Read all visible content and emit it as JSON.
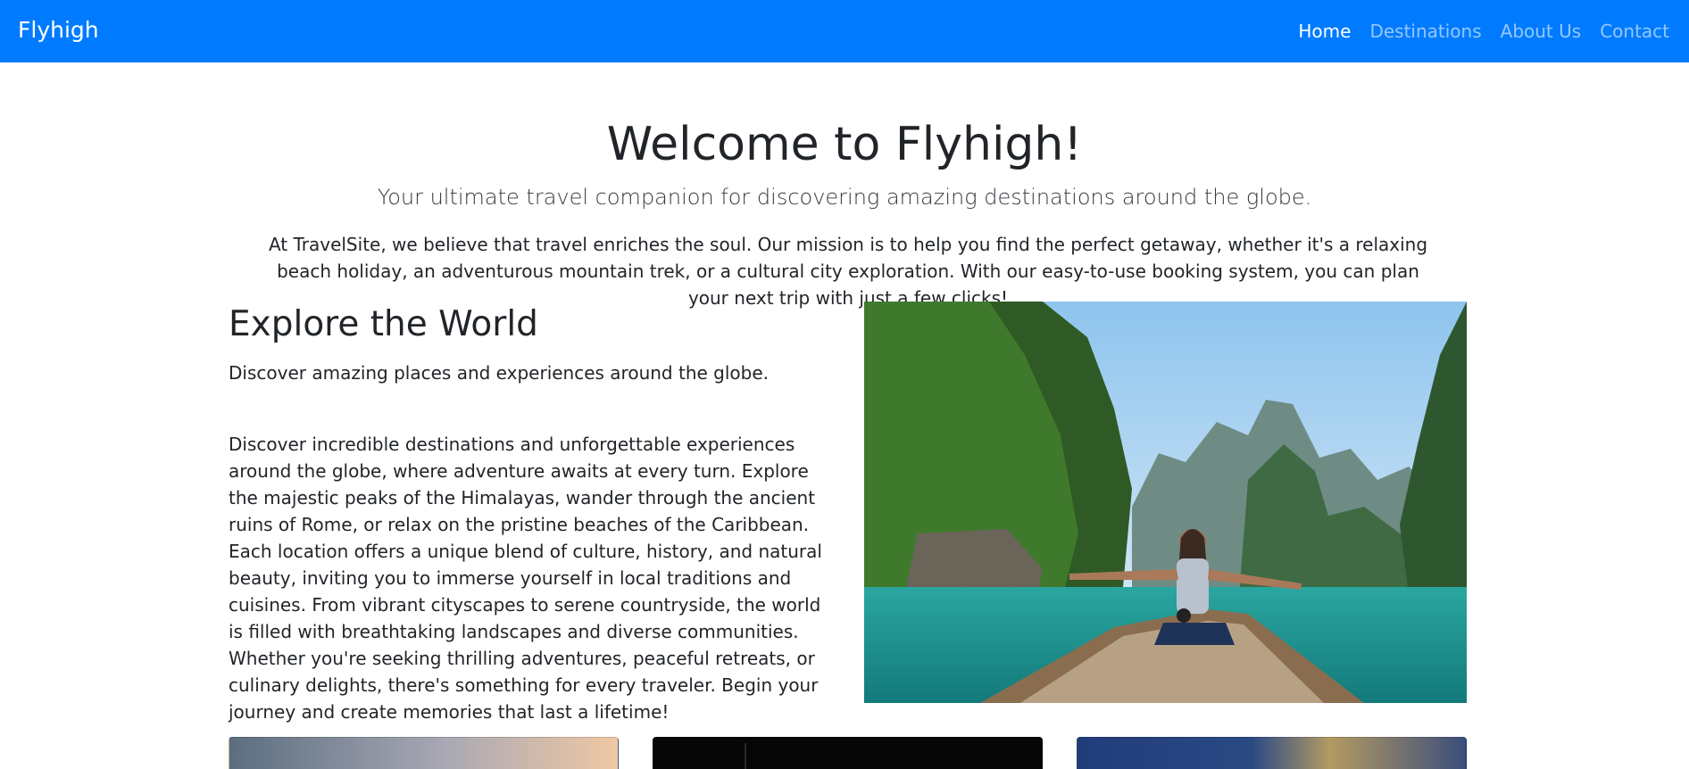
{
  "navbar": {
    "brand": "Flyhigh",
    "links": [
      {
        "label": "Home",
        "active": true
      },
      {
        "label": "Destinations",
        "active": false
      },
      {
        "label": "About Us",
        "active": false
      },
      {
        "label": "Contact",
        "active": false
      }
    ]
  },
  "hero": {
    "title": "Welcome to Flyhigh!",
    "subtitle": "Your ultimate travel companion for discovering amazing destinations around the globe.",
    "description": "At TravelSite, we believe that travel enriches the soul. Our mission is to help you find the perfect getaway, whether it's a relaxing beach holiday, an adventurous mountain trek, or a cultural city exploration. With our easy-to-use booking system, you can plan your next trip with just a few clicks!"
  },
  "explore": {
    "heading": "Explore the World",
    "lead": "Discover amazing places and experiences around the globe.",
    "body": "Discover incredible destinations and unforgettable experiences around the globe, where adventure awaits at every turn. Explore the majestic peaks of the Himalayas, wander through the ancient ruins of Rome, or relax on the pristine beaches of the Caribbean. Each location offers a unique blend of culture, history, and natural beauty, inviting you to immerse yourself in local traditions and cuisines. From vibrant cityscapes to serene countryside, the world is filled with breathtaking landscapes and diverse communities. Whether you're seeking thrilling adventures, peaceful retreats, or culinary delights, there's something for every traveler. Begin your journey and create memories that last a lifetime!"
  },
  "colors": {
    "navbar_bg": "#007bff",
    "nav_active": "#ffffff",
    "nav_inactive": "rgba(255,255,255,0.58)",
    "text": "#212529"
  }
}
